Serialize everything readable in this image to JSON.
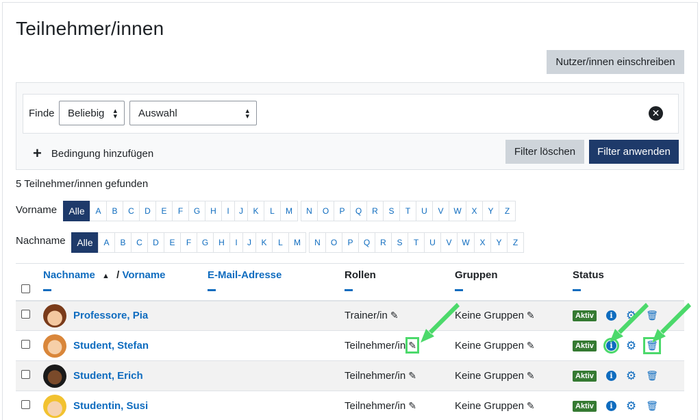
{
  "page_title": "Teilnehmer/innen",
  "enrol_button": "Nutzer/innen einschreiben",
  "filter": {
    "finde_label": "Finde",
    "match_select": "Beliebig",
    "type_select": "Auswahl",
    "add_condition": "Bedingung hinzufügen",
    "clear_button": "Filter löschen",
    "apply_button": "Filter anwenden"
  },
  "found_text": "5 Teilnehmer/innen gefunden",
  "initials": {
    "firstname_label": "Vorname",
    "lastname_label": "Nachname",
    "all_label": "Alle",
    "letters": [
      "A",
      "B",
      "C",
      "D",
      "E",
      "F",
      "G",
      "H",
      "I",
      "J",
      "K",
      "L",
      "M",
      "N",
      "O",
      "P",
      "Q",
      "R",
      "S",
      "T",
      "U",
      "V",
      "W",
      "X",
      "Y",
      "Z"
    ]
  },
  "table": {
    "col_lastname": "Nachname",
    "col_sep": "/",
    "col_firstname": "Vorname",
    "col_email": "E-Mail-Adresse",
    "col_roles": "Rollen",
    "col_groups": "Gruppen",
    "col_status": "Status",
    "rows": [
      {
        "name": "Professore, Pia",
        "role": "Trainer/in",
        "groups": "Keine Gruppen",
        "status": "Aktiv"
      },
      {
        "name": "Student, Stefan",
        "role": "Teilnehmer/in",
        "groups": "Keine Gruppen",
        "status": "Aktiv"
      },
      {
        "name": "Student, Erich",
        "role": "Teilnehmer/in",
        "groups": "Keine Gruppen",
        "status": "Aktiv"
      },
      {
        "name": "Studentin, Susi",
        "role": "Teilnehmer/in",
        "groups": "Keine Gruppen",
        "status": "Aktiv"
      }
    ]
  },
  "colors": {
    "primary": "#1e3a6a",
    "link": "#0f6cbf",
    "badge": "#357a32",
    "highlight": "#4cd96b"
  }
}
